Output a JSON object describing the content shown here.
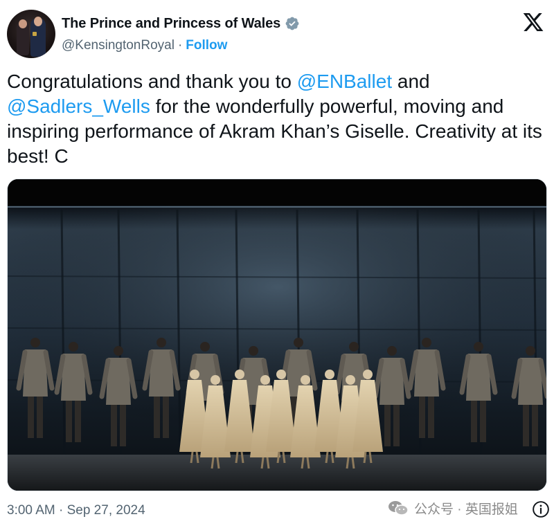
{
  "account": {
    "display_name": "The Prince and Princess of Wales",
    "handle": "@KensingtonRoyal",
    "separator": "·",
    "follow_label": "Follow",
    "verified_icon": "verified-badge-icon",
    "avatar_icon": "avatar"
  },
  "platform": {
    "logo_icon": "x-logo-icon"
  },
  "tweet": {
    "text_1": "Congratulations and thank you to ",
    "mention_1": "@ENBallet",
    "text_2": " and ",
    "mention_2": "@Sadlers_Wells",
    "text_3": " for the wonderfully powerful, moving and inspiring performance of Akram Khan’s Giselle. Creativity at its best! C",
    "timestamp": "3:00 AM · Sep 27, 2024"
  },
  "watermark": {
    "label": "公众号 · 英国报姐",
    "icon": "wechat-icon"
  },
  "info": {
    "icon": "info-icon"
  },
  "colors": {
    "text": "#0f1419",
    "secondary": "#536471",
    "accent": "#1d9bf0",
    "verified": "#829aab"
  }
}
